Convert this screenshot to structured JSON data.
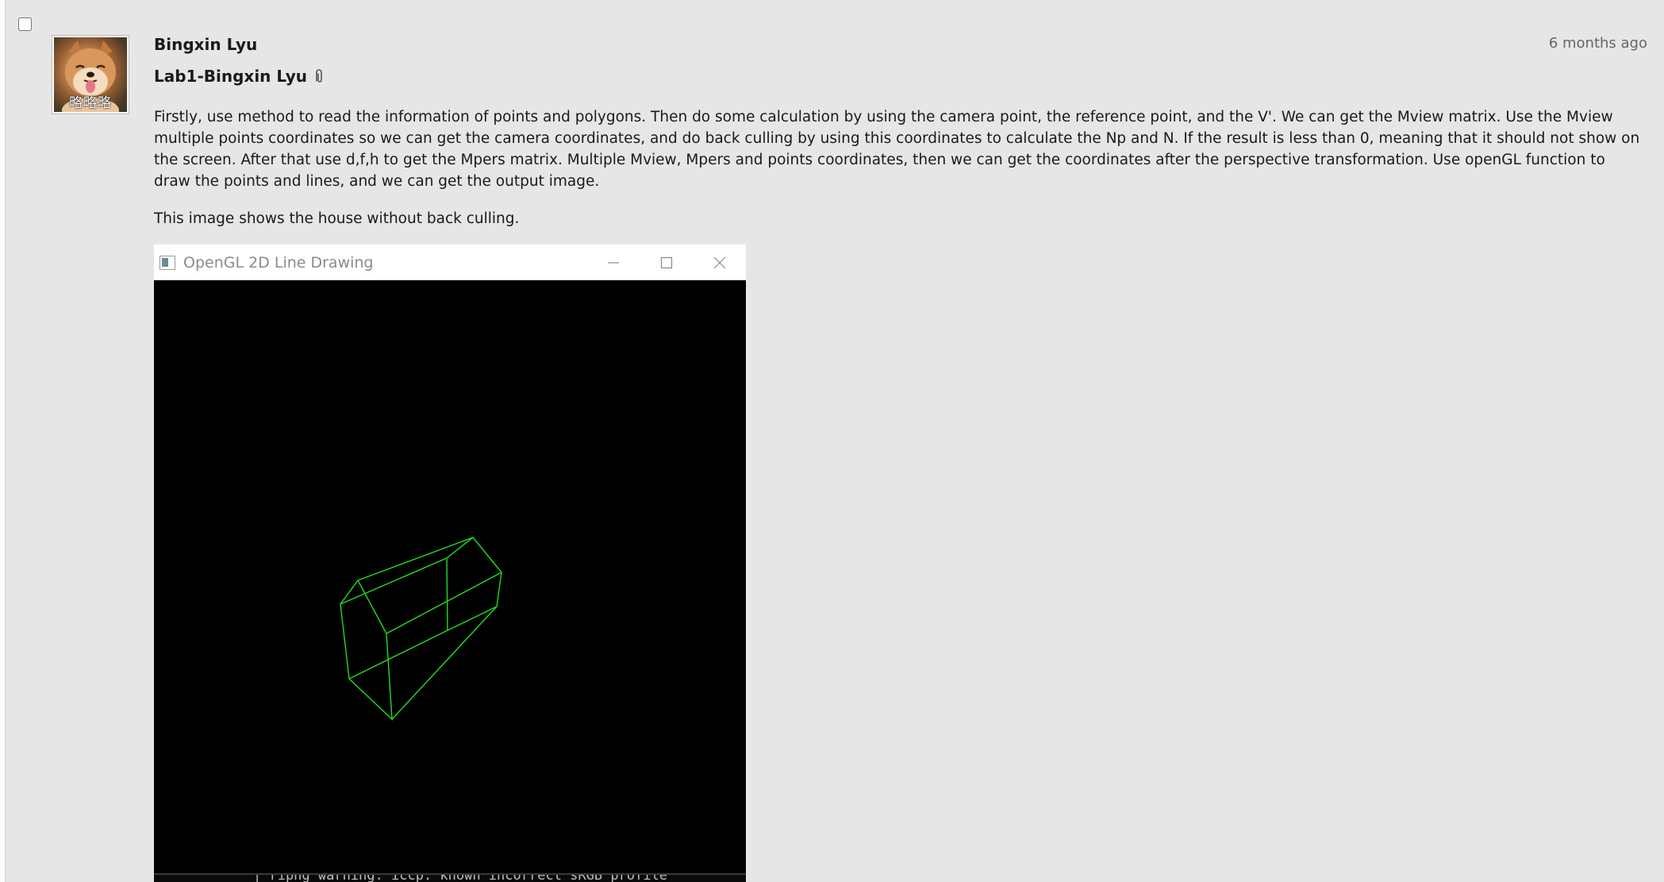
{
  "post": {
    "author": "Bingxin Lyu",
    "timestamp": "6 months ago",
    "title": "Lab1-Bingxin Lyu",
    "avatar_caption": "略略略",
    "body": "Firstly, use method to read the  information of points and polygons. Then do some calculation by using the camera point, the reference point, and the V'. We can get the Mview matrix. Use the Mview multiple points coordinates so we can get the camera coordinates, and do back culling by using this coordinates to calculate the Np and N. If the result is less than 0, meaning that it should not show on the screen. After that use d,f,h to get the Mpers matrix. Multiple Mview, Mpers and points coordinates, then we can get the coordinates after the perspective transformation. Use openGL function to draw the points and lines, and we can get the output image.",
    "caption": "This image shows the house without back culling."
  },
  "gl_window": {
    "title": "OpenGL 2D Line Drawing",
    "console_text": "| ripng warning: iccp: known incorrect sRGB profile",
    "line_color": "#22dd22"
  },
  "icons": {
    "select": "checkbox-icon",
    "attachment": "paperclip-icon",
    "window_app": "window-app-icon",
    "minimize": "minimize-icon",
    "maximize": "maximize-icon",
    "close": "close-icon"
  },
  "colors": {
    "page_bg": "#e6e6e6",
    "text": "#1a1a1a",
    "muted": "#666666"
  }
}
